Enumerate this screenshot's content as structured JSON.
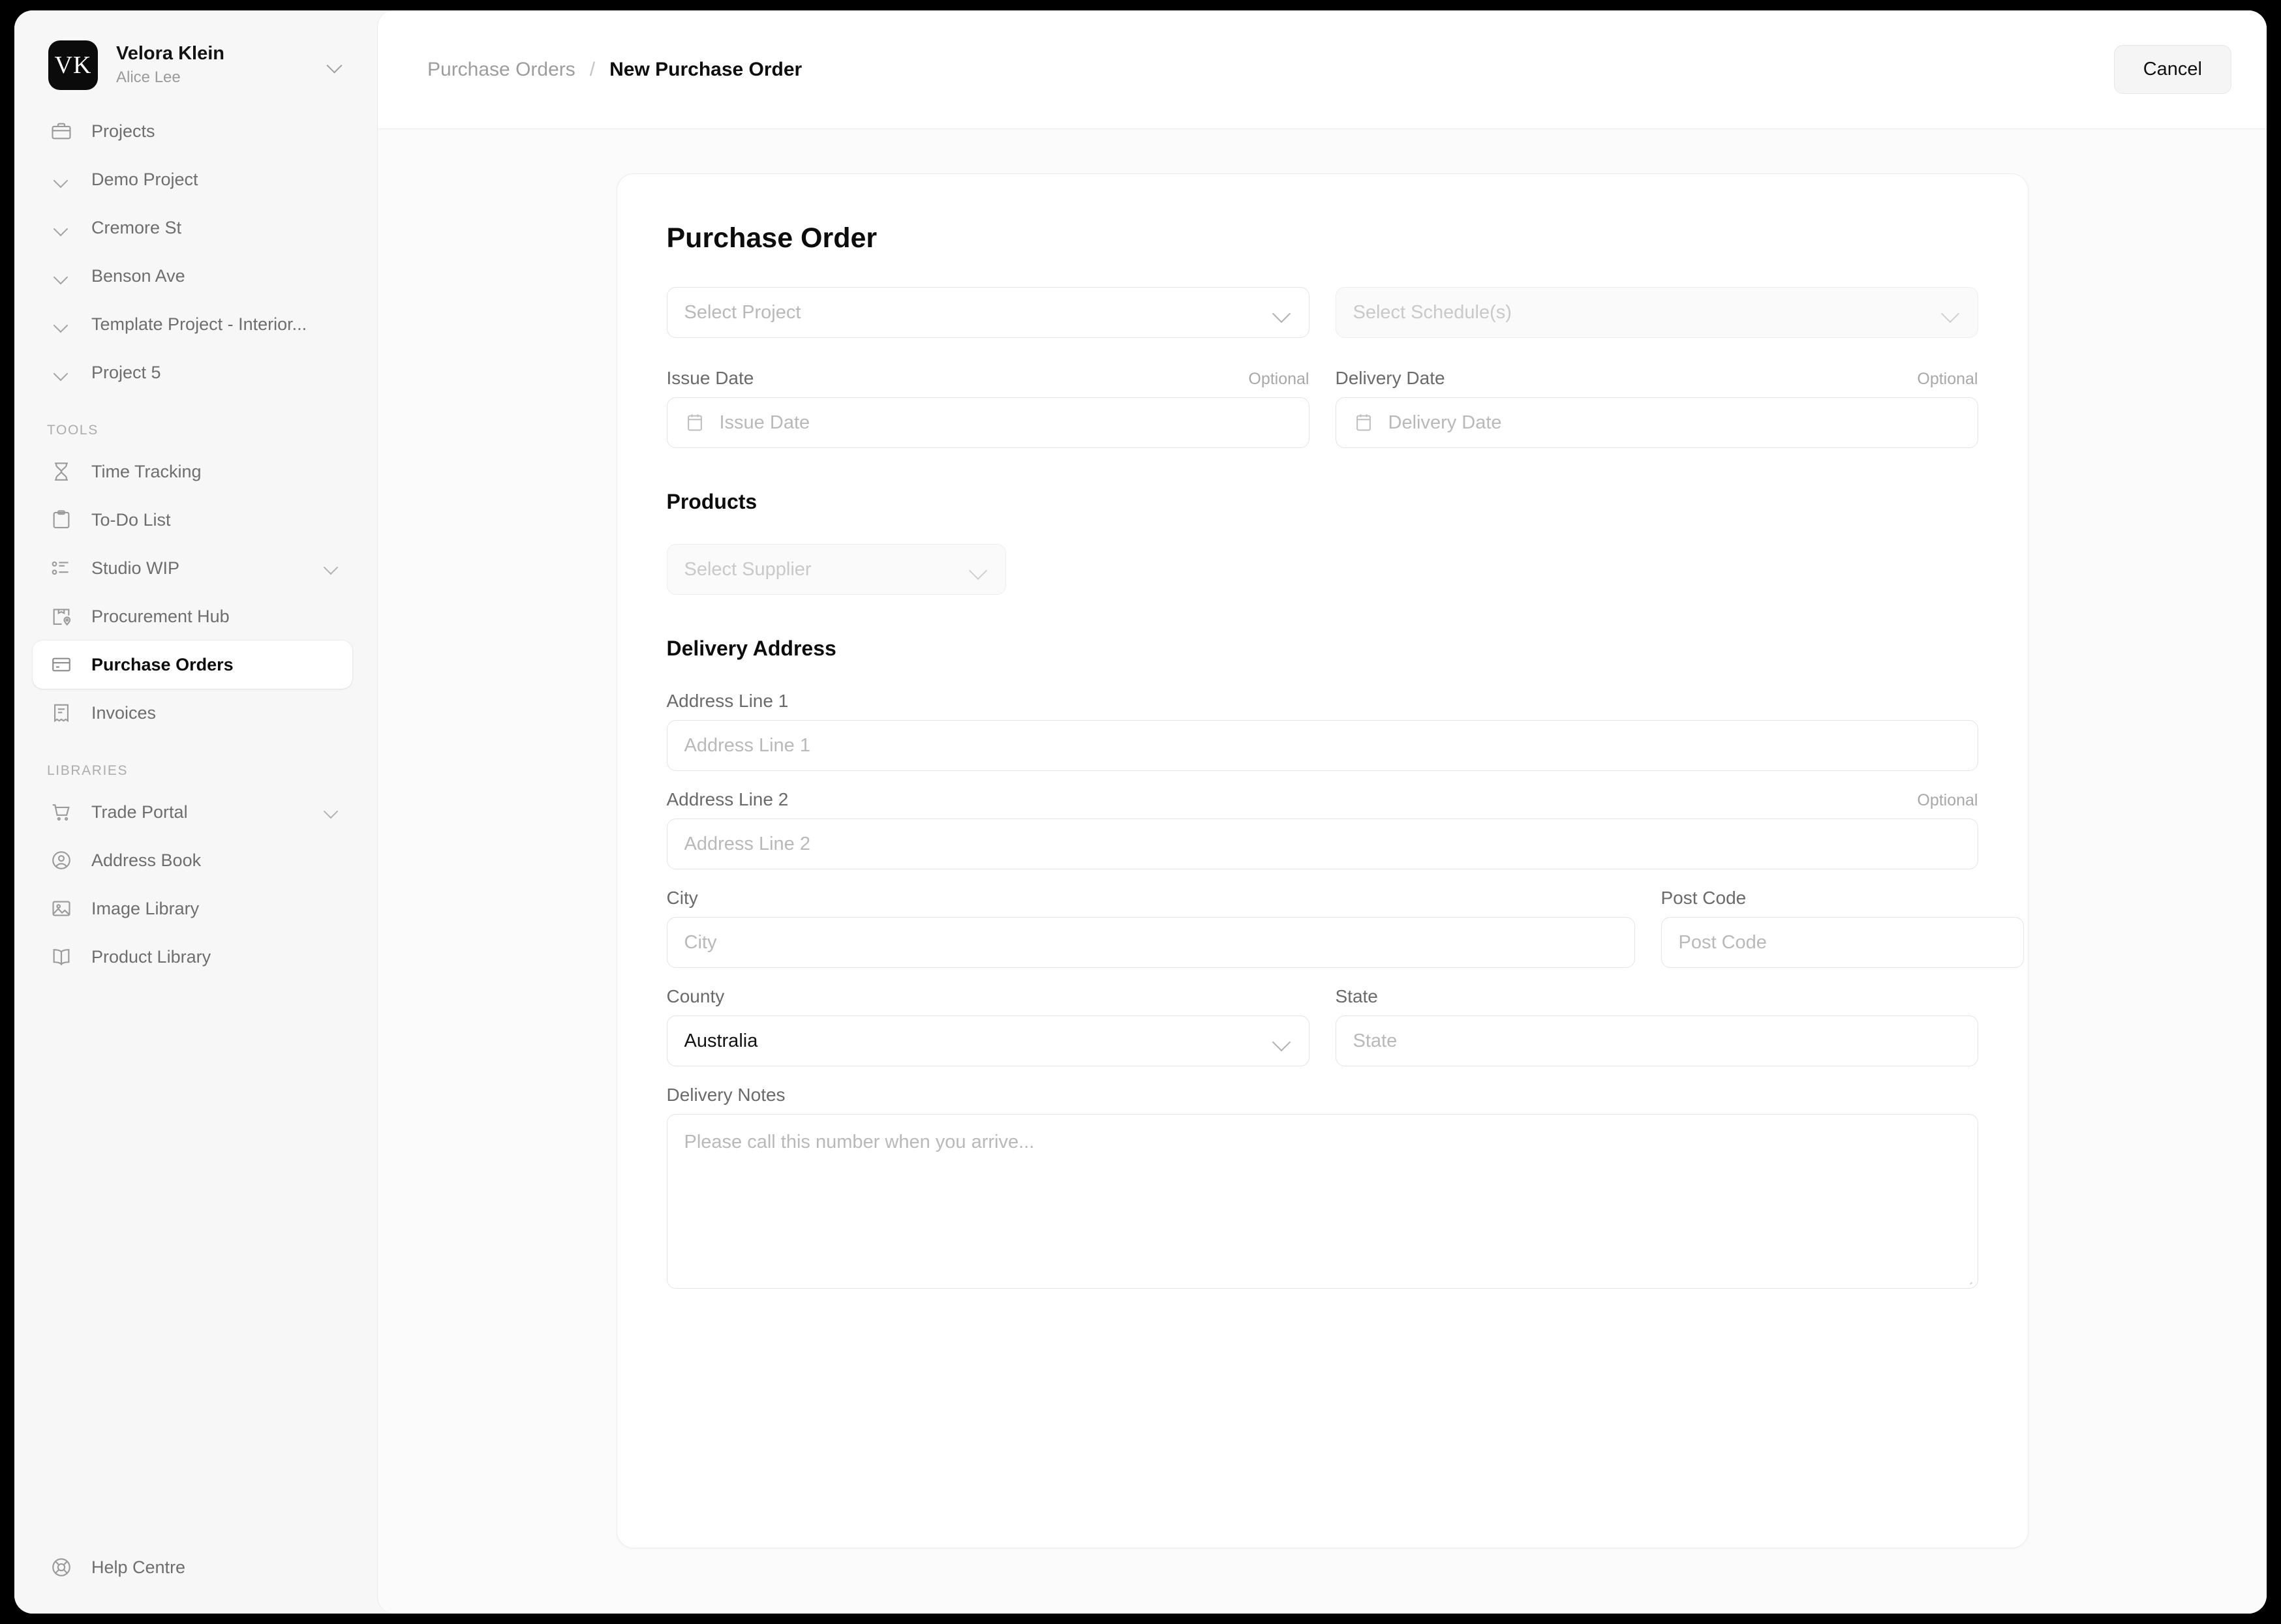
{
  "workspace": {
    "initials": "VK",
    "name": "Velora Klein",
    "user": "Alice Lee"
  },
  "sidebar": {
    "projects_label": "Projects",
    "projects": [
      {
        "label": "Demo Project"
      },
      {
        "label": "Cremore St"
      },
      {
        "label": "Benson Ave"
      },
      {
        "label": "Template Project - Interior..."
      },
      {
        "label": "Project 5"
      }
    ],
    "tools_heading": "TOOLS",
    "tools": [
      {
        "label": "Time Tracking",
        "icon": "hourglass-icon",
        "expandable": false,
        "active": false
      },
      {
        "label": "To-Do List",
        "icon": "clipboard-icon",
        "expandable": false,
        "active": false
      },
      {
        "label": "Studio WIP",
        "icon": "task-list-icon",
        "expandable": true,
        "active": false
      },
      {
        "label": "Procurement Hub",
        "icon": "package-pin-icon",
        "expandable": false,
        "active": false
      },
      {
        "label": "Purchase Orders",
        "icon": "card-icon",
        "expandable": false,
        "active": true
      },
      {
        "label": "Invoices",
        "icon": "receipt-icon",
        "expandable": false,
        "active": false
      }
    ],
    "libraries_heading": "LIBRARIES",
    "libraries": [
      {
        "label": "Trade Portal",
        "icon": "shopping-cart-icon",
        "expandable": true
      },
      {
        "label": "Address Book",
        "icon": "user-circle-icon",
        "expandable": false
      },
      {
        "label": "Image Library",
        "icon": "image-icon",
        "expandable": false
      },
      {
        "label": "Product Library",
        "icon": "book-icon",
        "expandable": false
      }
    ],
    "help": {
      "label": "Help Centre",
      "icon": "lifebuoy-icon"
    }
  },
  "topbar": {
    "breadcrumb_parent": "Purchase Orders",
    "breadcrumb_separator": "/",
    "breadcrumb_current": "New Purchase Order",
    "cancel_label": "Cancel"
  },
  "form": {
    "title": "Purchase Order",
    "project_select": {
      "value": "Select Project",
      "is_placeholder": true
    },
    "schedule_select": {
      "value": "Select Schedule(s)",
      "is_placeholder": true,
      "disabled": true
    },
    "issue_date": {
      "label": "Issue Date",
      "optional": "Optional",
      "placeholder": "Issue Date"
    },
    "delivery_date": {
      "label": "Delivery Date",
      "optional": "Optional",
      "placeholder": "Delivery Date"
    },
    "products_heading": "Products",
    "supplier_select": {
      "value": "Select Supplier",
      "is_placeholder": true,
      "disabled": true
    },
    "delivery_address_heading": "Delivery Address",
    "address_line_1": {
      "label": "Address Line 1",
      "placeholder": "Address Line 1",
      "optional": ""
    },
    "address_line_2": {
      "label": "Address Line 2",
      "placeholder": "Address Line 2",
      "optional": "Optional"
    },
    "city": {
      "label": "City",
      "placeholder": "City"
    },
    "post_code": {
      "label": "Post Code",
      "placeholder": "Post Code"
    },
    "county": {
      "label": "County",
      "value": "Australia"
    },
    "state": {
      "label": "State",
      "placeholder": "State"
    },
    "delivery_notes": {
      "label": "Delivery Notes",
      "placeholder": "Please call this number when you arrive..."
    }
  },
  "colors": {
    "page_bg": "#f7f7f7",
    "card_bg": "#ffffff",
    "accent_dark": "#0b0b0b",
    "muted_text": "#9b9b9b",
    "border": "#e4e4e4"
  }
}
